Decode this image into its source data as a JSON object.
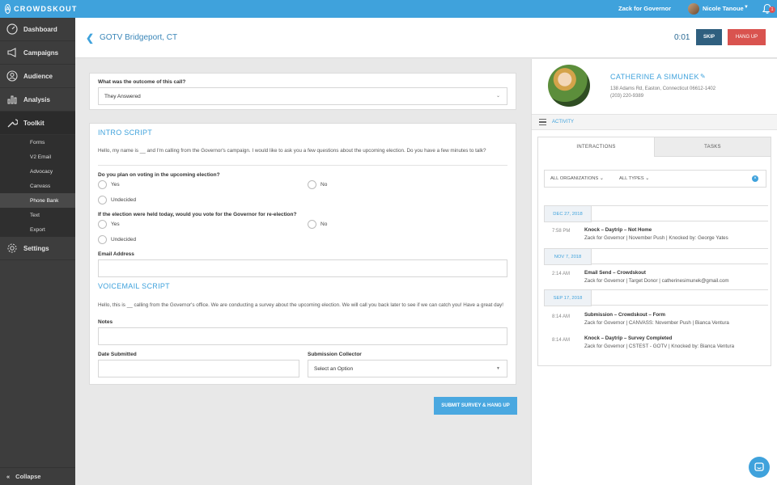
{
  "app": {
    "brand": "CROWDSKOUT",
    "logo_glyph": "A",
    "org_name": "Zack for Governor",
    "user_name": "Nicole Tanoue",
    "notification_count": "1"
  },
  "sidebar": {
    "items": [
      {
        "label": "Dashboard",
        "icon": "gauge-icon"
      },
      {
        "label": "Campaigns",
        "icon": "megaphone-icon"
      },
      {
        "label": "Audience",
        "icon": "person-icon"
      },
      {
        "label": "Analysis",
        "icon": "bar-chart-icon"
      },
      {
        "label": "Toolkit",
        "icon": "wrench-icon"
      }
    ],
    "toolkit_sub": [
      "Forms",
      "V2 Email",
      "Advocacy",
      "Canvass",
      "Phone Bank",
      "Text",
      "Export"
    ],
    "settings_label": "Settings",
    "collapse_label": "Collapse"
  },
  "header": {
    "title": "GOTV Bridgeport, CT",
    "timer": "0:01",
    "skip_label": "SKIP",
    "hangup_label": "HANG UP"
  },
  "survey": {
    "outcome_question": "What was the outcome of this call?",
    "outcome_value": "They Answered",
    "intro_title": "INTRO SCRIPT",
    "intro_text": "Hello, my name is __ and I'm calling from the Governor's campaign. I would like to ask you a few questions about the upcoming election. Do you have a few minutes to talk?",
    "q1": "Do you plan on voting in the upcoming election?",
    "q2": "If the election were held today, would you vote for the Governor for re-election?",
    "opt_yes": "Yes",
    "opt_no": "No",
    "opt_undecided": "Undecided",
    "email_label": "Email Address",
    "voicemail_title": "VOICEMAIL SCRIPT",
    "voicemail_text": "Hello, this is __ calling from the Governor's office. We are conducting a survey about the upcoming election. We will call you back later to see if we can catch you! Have a great day!",
    "notes_label": "Notes",
    "date_label": "Date Submitted",
    "collector_label": "Submission Collector",
    "collector_placeholder": "Select an Option",
    "submit_label": "SUBMIT SURVEY & HANG UP"
  },
  "contact": {
    "name": "CATHERINE A SIMUNEK",
    "address": "138 Adams Rd, Easton, Connecticut 06612-1402",
    "phone": "(203) 220-9389",
    "activity_label": "ACTIVITY",
    "tabs": [
      "INTERACTIONS",
      "TASKS"
    ],
    "filter_orgs": "ALL ORGANIZATIONS",
    "filter_types": "ALL TYPES",
    "groups": [
      {
        "date": "DEC 27, 2018",
        "entries": [
          {
            "time": "7:58 PM",
            "title": "Knock – Daytrip – Not Home",
            "sub": "Zack for Governor | November Push | Knocked by: George Yates"
          }
        ]
      },
      {
        "date": "NOV 7, 2018",
        "entries": [
          {
            "time": "2:14 AM",
            "title": "Email Send – Crowdskout",
            "sub": "Zack for Governor | Target Donor | catherinesimunek@gmail.com"
          }
        ]
      },
      {
        "date": "SEP 17, 2018",
        "entries": [
          {
            "time": "8:14 AM",
            "title": "Submission – Crowdskout – Form",
            "sub": "Zack for Governor | CANVASS: November Push | Bianca Ventura"
          },
          {
            "time": "8:14 AM",
            "title": "Knock – Daytrip – Survey Completed",
            "sub": "Zack for Governor | CSTEST - GOTV | Knocked by: Bianca Ventura"
          }
        ]
      }
    ]
  },
  "colors": {
    "accent": "#3fa2dc",
    "sidebar_bg": "#3d3d3d",
    "skip_bg": "#2f5f7f",
    "hangup_bg": "#d9534f"
  }
}
